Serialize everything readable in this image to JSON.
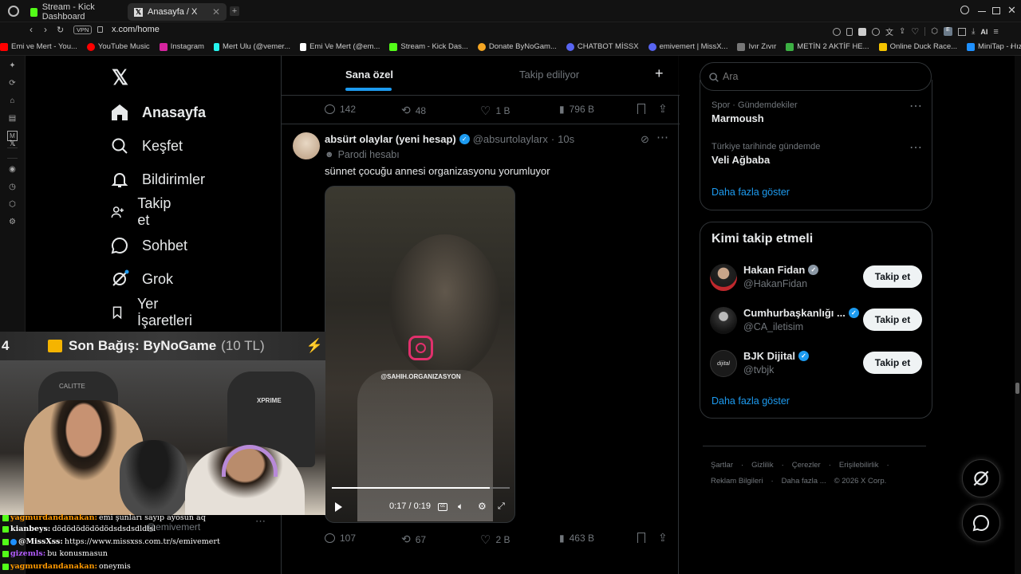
{
  "browser": {
    "tabs": [
      {
        "label": "Stream - Kick Dashboard",
        "active": false
      },
      {
        "label": "Anasayfa / X",
        "active": true
      }
    ],
    "vpn_label": "VPN",
    "url": "x.com/home",
    "ext_label": "AI"
  },
  "bookmarks": [
    {
      "label": "Emi ve Mert - You...",
      "color": "#ff0000"
    },
    {
      "label": "YouTube Music",
      "color": "#ff0000"
    },
    {
      "label": "Instagram",
      "color": "#d6249f"
    },
    {
      "label": "Mert Ulu (@vemer...",
      "color": "#25f4ee"
    },
    {
      "label": "Emi Ve Mert (@em...",
      "color": "#ffffff"
    },
    {
      "label": "Stream - Kick Das...",
      "color": "#53fc18"
    },
    {
      "label": "Donate ByNoGam...",
      "color": "#f5a623"
    },
    {
      "label": "CHATBOT MİSSX",
      "color": "#5865f2"
    },
    {
      "label": "emivemert | MissX...",
      "color": "#5865f2"
    },
    {
      "label": "Ivır Zıvır",
      "color": "#777777"
    },
    {
      "label": "METİN 2 AKTİF HE...",
      "color": "#3cb043"
    },
    {
      "label": "Online Duck Race...",
      "color": "#f5c400"
    },
    {
      "label": "MiniTap - Hızlı ve...",
      "color": "#1e90ff"
    }
  ],
  "nav": {
    "items": [
      {
        "label": "Anasayfa",
        "icon": "home-icon"
      },
      {
        "label": "Keşfet",
        "icon": "search-icon"
      },
      {
        "label": "Bildirimler",
        "icon": "bell-icon"
      },
      {
        "label": "Takip et",
        "icon": "add-user-icon"
      },
      {
        "label": "Sohbet",
        "icon": "chat-icon"
      },
      {
        "label": "Grok",
        "icon": "grok-icon"
      },
      {
        "label": "Yer İşaretleri",
        "icon": "bookmark-icon"
      }
    ]
  },
  "feed": {
    "tabs": {
      "for_you": "Sana özel",
      "following": "Takip ediliyor"
    },
    "prev_post_actions": {
      "replies": "142",
      "reposts": "48",
      "likes": "1 B",
      "views": "796 B"
    },
    "post": {
      "author": "absürt olaylar (yeni hesap)",
      "handle": "@absurtolaylarx",
      "time": "10s",
      "label": "Parodi hesabı",
      "text": "sünnet çocuğu annesi organizasyonu yorumluyor",
      "watermark": "@SAHIH.ORGANIZASYON",
      "video_time": "0:17 / 0:19",
      "video_progress": 0.89,
      "actions": {
        "replies": "107",
        "reposts": "67",
        "likes": "2 B",
        "views": "463 B"
      }
    }
  },
  "right": {
    "search_placeholder": "Ara",
    "trends": [
      {
        "context": "Spor · Gündemdekiler",
        "title": "Marmoush"
      },
      {
        "context": "Türkiye tarihinde gündemde",
        "title": "Veli Ağbaba"
      }
    ],
    "trends_more": "Daha fazla göster",
    "who_to_follow": {
      "title": "Kimi takip etmeli",
      "users": [
        {
          "name": "Hakan Fidan",
          "handle": "@HakanFidan",
          "badge": "gray",
          "button": "Takip et"
        },
        {
          "name": "Cumhurbaşkanlığı ...",
          "handle": "@CA_iletisim",
          "badge": "blue",
          "button": "Takip et"
        },
        {
          "name": "BJK Dijital",
          "handle": "@tvbjk",
          "badge": "blue",
          "button": "Takip et",
          "avatar_text": "dijital"
        }
      ],
      "more": "Daha fazla göster"
    },
    "footer": {
      "row1": [
        "Şartlar",
        "Gizlilik",
        "Çerezler",
        "Erişilebilirlik"
      ],
      "row2": [
        "Reklam Bilgileri",
        "Daha fazla ...",
        "© 2026 X Corp."
      ]
    }
  },
  "stream": {
    "banner_prefix": "4",
    "banner_text": "Son Bağış: ByNoGame",
    "banner_amount": "(10 TL)",
    "cam_label_left": "CALITTE",
    "cam_label_right": "XPRIME",
    "partial_handle": "@emivemert"
  },
  "chat": [
    {
      "user": "yagmurdandanakan:",
      "msg": "emi şunları sayıp ayosun aq",
      "color": "#ff9900"
    },
    {
      "user": "kianbeys:",
      "msg": "dödödödödödödsdsdsdldlsl",
      "color": "#ffffff"
    },
    {
      "user": "@MissXss:",
      "msg": "https://www.missxss.com.tr/s/emivemert",
      "color": "#ffffff"
    },
    {
      "user": "gizemls:",
      "msg": "bu konusmasun",
      "color": "#b35cff"
    },
    {
      "user": "yagmurdandanakan:",
      "msg": "oneymis",
      "color": "#ff9900"
    }
  ]
}
